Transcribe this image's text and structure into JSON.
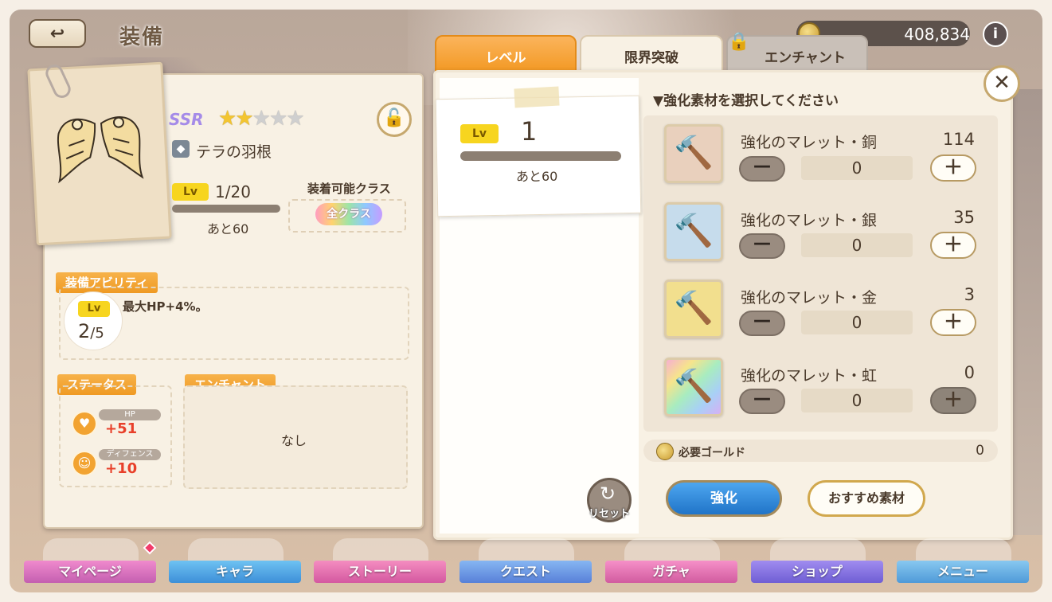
{
  "header": {
    "back_icon": "back-arrow-icon",
    "title": "装備",
    "gold": "408,834",
    "info_label": "i"
  },
  "item": {
    "rarity": "SSR",
    "stars_filled": 2,
    "stars_total": 5,
    "name": "テラの羽根",
    "lv_badge": "Lv",
    "level": "1/20",
    "remaining": "あと60",
    "class_label": "装着可能クラス",
    "class_value": "全クラス"
  },
  "ability": {
    "tag": "装備アビリティ",
    "lv_badge": "Lv",
    "lv_current": "2",
    "lv_max": "/5",
    "text": "最大HP+4%。"
  },
  "status": {
    "tag": "ステータス",
    "hp_label": "HP",
    "hp_value": "+51",
    "def_label": "ディフェンス",
    "def_value": "+10"
  },
  "enchant": {
    "tag": "エンチャント",
    "value": "なし"
  },
  "tabs": [
    {
      "label": "レベル",
      "active": true
    },
    {
      "label": "限界突破",
      "active": false
    },
    {
      "label": "エンチャント",
      "active": false,
      "locked": true
    }
  ],
  "level_card": {
    "lv_badge": "Lv",
    "level": "1",
    "remaining": "あと60"
  },
  "materials": {
    "title": "▼強化素材を選択してください",
    "items": [
      {
        "name": "強化のマレット・銅",
        "count": "114",
        "qty": "0",
        "color": "#e9d0bd"
      },
      {
        "name": "強化のマレット・銀",
        "count": "35",
        "qty": "0",
        "color": "#c6dcec"
      },
      {
        "name": "強化のマレット・金",
        "count": "3",
        "qty": "0",
        "color": "#f2df8e"
      },
      {
        "name": "強化のマレット・虹",
        "count": "0",
        "qty": "0",
        "color": "#e6c8f0"
      }
    ],
    "minus_label": "－",
    "plus_label": "＋"
  },
  "required_gold": {
    "label": "必要ゴールド",
    "value": "0"
  },
  "actions": {
    "reset": "リセット",
    "enhance": "強化",
    "recommend": "おすすめ素材"
  },
  "nav": [
    {
      "label": "マイページ"
    },
    {
      "label": "キャラ"
    },
    {
      "label": "ストーリー"
    },
    {
      "label": "クエスト"
    },
    {
      "label": "ガチャ"
    },
    {
      "label": "ショップ"
    },
    {
      "label": "メニュー"
    }
  ],
  "colors": {
    "accent": "#f39a26",
    "enhance": "#2074c8",
    "text": "#4a3a2b"
  }
}
